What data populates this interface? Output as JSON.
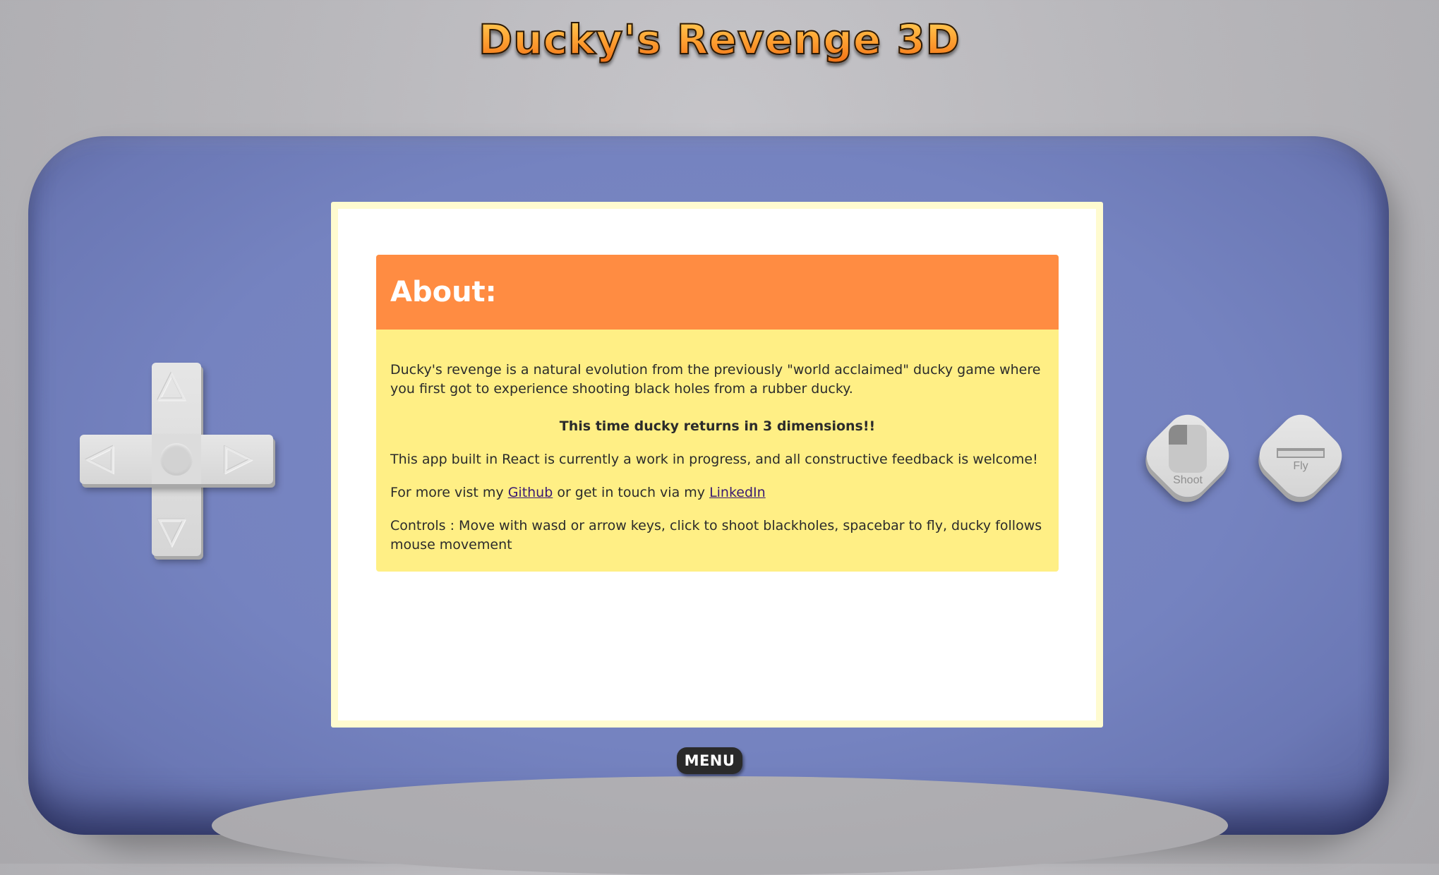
{
  "title": "Ducky's Revenge 3D",
  "about": {
    "heading": "About:",
    "paragraph1": "Ducky's revenge is a natural evolution from the previously \"world acclaimed\" ducky game where you first got to experience shooting black holes from a rubber ducky.",
    "highlight": "This time ducky returns in 3 dimensions!!",
    "paragraph2": "This app built in React is currently a work in progress, and all constructive feedback is welcome!",
    "more_prefix": "For more vist my ",
    "github_link": "Github",
    "more_middle": " or get in touch via my ",
    "linkedin_link": "LinkedIn",
    "controls": "Controls : Move with wasd or arrow keys, click to shoot blackholes, spacebar to fly, ducky follows mouse movement"
  },
  "buttons": {
    "shoot_label": "Shoot",
    "fly_label": "Fly",
    "menu_label": "MENU"
  },
  "dpad_glyphs": {
    "up": "△",
    "down": "▽",
    "left": "◁",
    "right": "▷"
  },
  "colors": {
    "console": "#7583c0",
    "header": "#ff8c42",
    "card": "#ffef85",
    "screen_frame": "#fffbd0",
    "title_orange": "#f68a1e"
  },
  "icons": {
    "shoot": "mouse-icon",
    "fly": "spacebar-icon"
  }
}
